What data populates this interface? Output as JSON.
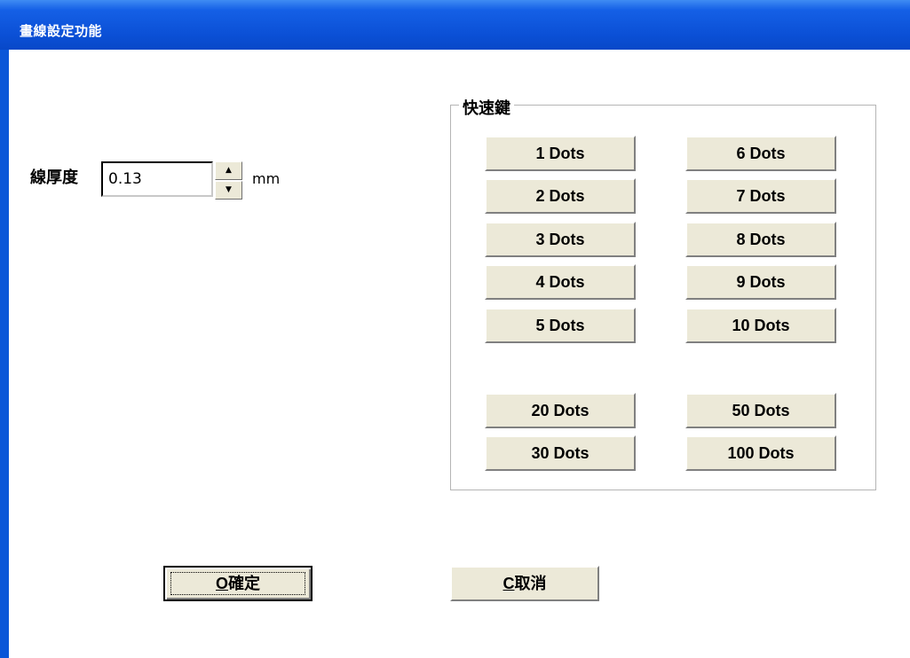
{
  "window": {
    "title": "畫線設定功能"
  },
  "thickness": {
    "label": "線厚度",
    "value": "0.13",
    "unit": "mm",
    "spin_up": "▲",
    "spin_down": "▼"
  },
  "quick_keys": {
    "title": "快速鍵",
    "left_column": [
      "1 Dots",
      "2 Dots",
      "3 Dots",
      "4 Dots",
      "5 Dots"
    ],
    "right_column": [
      "6 Dots",
      "7 Dots",
      "8 Dots",
      "9 Dots",
      "10 Dots"
    ],
    "extra_left": [
      "20 Dots",
      "30 Dots"
    ],
    "extra_right": [
      "50 Dots",
      "100 Dots"
    ]
  },
  "actions": {
    "ok_mnemonic": "O",
    "ok_label": "確定",
    "cancel_mnemonic": "C",
    "cancel_label": "取消"
  },
  "colors": {
    "titlebar": "#0b50d6",
    "button_face": "#ece9d8"
  }
}
